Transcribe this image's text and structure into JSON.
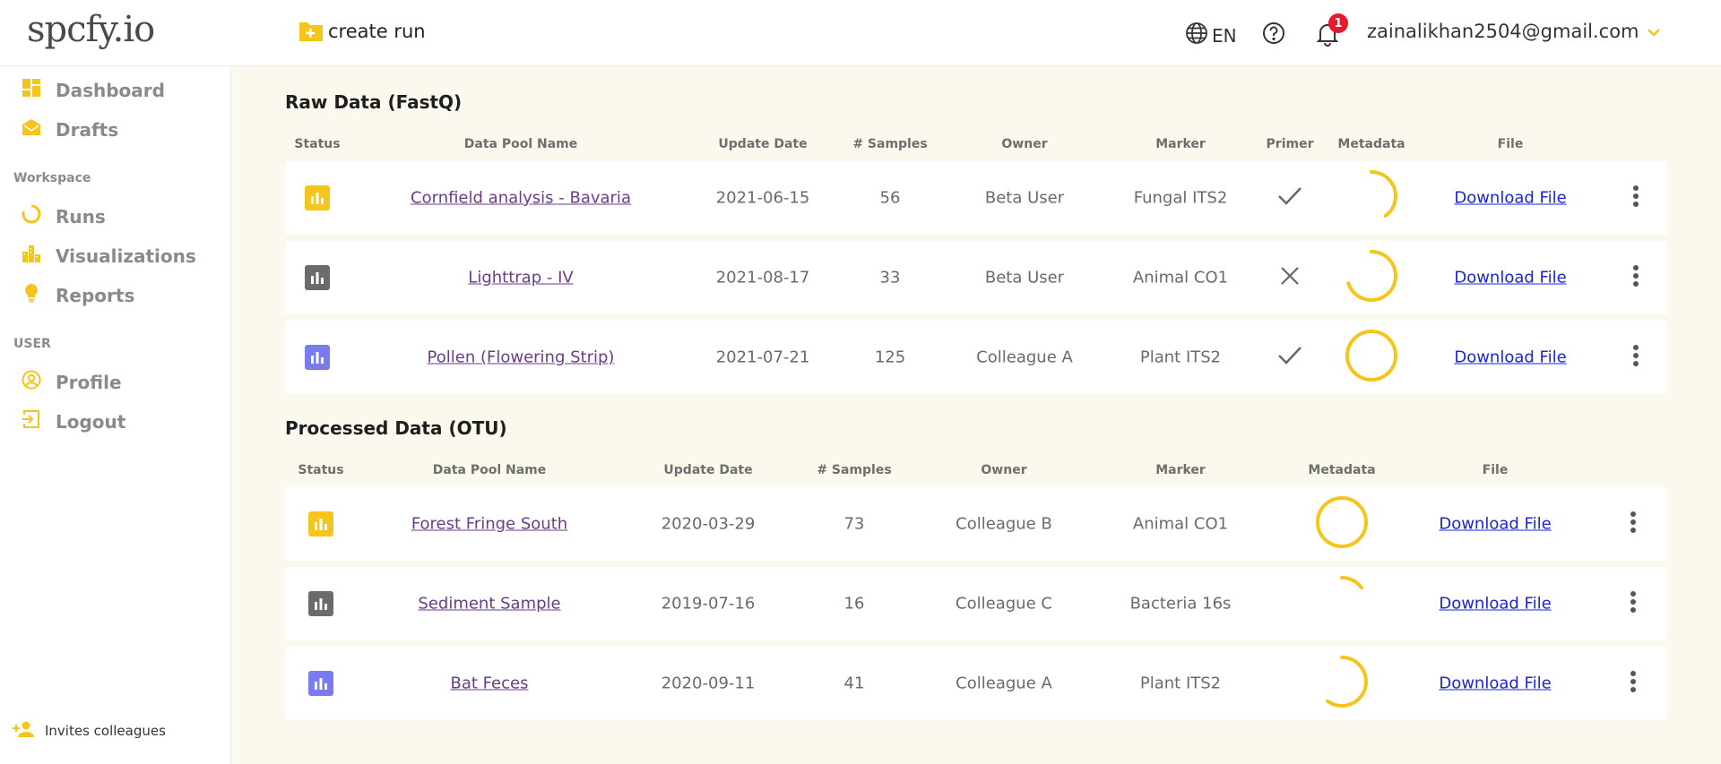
{
  "app": {
    "logo": "spcfy.io",
    "create_run": "create run",
    "language": "EN",
    "notifications_count": "1",
    "user_email": "zainalikhan2504@gmail.com"
  },
  "colors": {
    "accent": "#f5c51c",
    "status_yellow": "#f5c51c",
    "status_grey": "#6b6b6b",
    "status_purple": "#7b7bf0",
    "progress": "#f5c51c",
    "link": "#1b25d8",
    "name_link": "#6a3c8a",
    "badge": "#e8192c"
  },
  "sidebar": {
    "items": [
      {
        "label": "Dashboard",
        "icon": "dashboard-icon"
      },
      {
        "label": "Drafts",
        "icon": "drafts-icon"
      }
    ],
    "workspace_label": "Workspace",
    "workspace_items": [
      {
        "label": "Runs",
        "icon": "runs-icon"
      },
      {
        "label": "Visualizations",
        "icon": "visualizations-icon"
      },
      {
        "label": "Reports",
        "icon": "reports-icon"
      }
    ],
    "user_label": "USER",
    "user_items": [
      {
        "label": "Profile",
        "icon": "profile-icon"
      },
      {
        "label": "Logout",
        "icon": "logout-icon"
      }
    ],
    "invites": "Invites colleagues"
  },
  "raw": {
    "title": "Raw Data (FastQ)",
    "headers": {
      "status": "Status",
      "name": "Data Pool Name",
      "date": "Update Date",
      "samples": "# Samples",
      "owner": "Owner",
      "marker": "Marker",
      "primer": "Primer",
      "metadata": "Metadata",
      "file": "File"
    },
    "rows": [
      {
        "status": "yellow",
        "name": "Cornfield analysis - Bavaria",
        "date": "2021-06-15",
        "samples": "56",
        "owner": "Beta User",
        "marker": "Fungal ITS2",
        "primer": "check",
        "metadata": 0.4,
        "file": "Download File"
      },
      {
        "status": "grey",
        "name": "Lighttrap - IV",
        "date": "2021-08-17",
        "samples": "33",
        "owner": "Beta User",
        "marker": "Animal CO1",
        "primer": "cross",
        "metadata": 0.7,
        "file": "Download File"
      },
      {
        "status": "purple",
        "name": "Pollen (Flowering Strip)",
        "date": "2021-07-21",
        "samples": "125",
        "owner": "Colleague A",
        "marker": "Plant ITS2",
        "primer": "check",
        "metadata": 1.0,
        "file": "Download File"
      }
    ]
  },
  "processed": {
    "title": "Processed Data (OTU)",
    "headers": {
      "status": "Status",
      "name": "Data Pool Name",
      "date": "Update Date",
      "samples": "# Samples",
      "owner": "Owner",
      "marker": "Marker",
      "metadata": "Metadata",
      "file": "File"
    },
    "rows": [
      {
        "status": "yellow",
        "name": "Forest Fringe South",
        "date": "2020-03-29",
        "samples": "73",
        "owner": "Colleague B",
        "marker": "Animal CO1",
        "metadata": 1.0,
        "file": "Download File"
      },
      {
        "status": "grey",
        "name": "Sediment Sample",
        "date": "2019-07-16",
        "samples": "16",
        "owner": "Colleague C",
        "marker": "Bacteria 16s",
        "metadata": 0.15,
        "file": "Download File"
      },
      {
        "status": "purple",
        "name": "Bat Feces",
        "date": "2020-09-11",
        "samples": "41",
        "owner": "Colleague A",
        "marker": "Plant ITS2",
        "metadata": 0.6,
        "file": "Download File"
      }
    ]
  }
}
